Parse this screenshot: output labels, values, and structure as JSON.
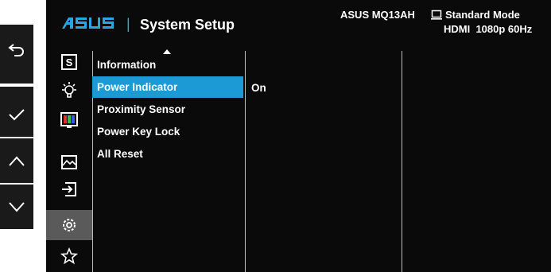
{
  "brand": "ASUS",
  "header": {
    "title": "System Setup",
    "model": "ASUS MQ13AH",
    "mode": "Standard Mode",
    "input_info": "HDMI  1080p 60Hz"
  },
  "side_buttons": [
    "back-icon",
    "check-icon",
    "up-icon",
    "down-icon"
  ],
  "category_icons": [
    "splendid-icon",
    "eye-care-icon",
    "color-icon",
    "image-icon",
    "input-select-icon",
    "system-setup-icon",
    "shortcut-icon"
  ],
  "menu": {
    "items": [
      {
        "label": "Information"
      },
      {
        "label": "Power Indicator"
      },
      {
        "label": "Proximity Sensor"
      },
      {
        "label": "Power Key Lock"
      },
      {
        "label": "All Reset"
      }
    ],
    "selected_value": "On"
  },
  "colors": {
    "accent": "#1b9ad6",
    "osd_background": "#0a0a0a",
    "active_icon_bg": "#5a5a5a",
    "side_panel": "#1a1a1a"
  }
}
